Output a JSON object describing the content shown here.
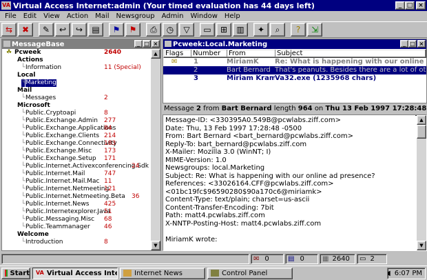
{
  "window": {
    "title": "Virtual Access Internet:admin (Your timed evaluation has 44 days left)",
    "app_icon": "VA"
  },
  "menu": [
    "File",
    "Edit",
    "View",
    "Action",
    "Mail",
    "Newsgroup",
    "Admin",
    "Window",
    "Help"
  ],
  "toolbar_icons": [
    "connect-icon",
    "stop-icon",
    "compose-icon",
    "reply-icon",
    "forward-icon",
    "address-book-icon",
    "flag-blue-icon",
    "flag-red-icon",
    "print-icon",
    "schedule-icon",
    "filter-icon",
    "tile-icon",
    "layout-four-icon",
    "layout-icon",
    "scripts-icon",
    "find-icon",
    "help-icon",
    "exit-icon"
  ],
  "message_base": {
    "title": "MessageBase",
    "rows": [
      {
        "label": "Pcweek",
        "count": "2640",
        "level": 0,
        "bold": true
      },
      {
        "label": "Actions",
        "count": "",
        "level": 1,
        "bold": true
      },
      {
        "label": "Information",
        "count": "11 (Special)",
        "level": 2,
        "bold": false
      },
      {
        "label": "Local",
        "count": "",
        "level": 1,
        "bold": true
      },
      {
        "label": "Marketing",
        "count": "",
        "level": 2,
        "bold": false,
        "selected": true
      },
      {
        "label": "Mail",
        "count": "",
        "level": 1,
        "bold": true
      },
      {
        "label": "Messages",
        "count": "2",
        "level": 2,
        "bold": false
      },
      {
        "label": "Microsoft",
        "count": "",
        "level": 1,
        "bold": true
      },
      {
        "label": "Public.Cryptoapi",
        "count": "8",
        "level": 2,
        "bold": false
      },
      {
        "label": "Public.Exchange.Admin",
        "count": "277",
        "level": 2,
        "bold": false
      },
      {
        "label": "Public.Exchange.Applications",
        "count": "84",
        "level": 2,
        "bold": false
      },
      {
        "label": "Public.Exchange.Clients",
        "count": "214",
        "level": 2,
        "bold": false
      },
      {
        "label": "Public.Exchange.Connectivity",
        "count": "183",
        "level": 2,
        "bold": false
      },
      {
        "label": "Public.Exchange.Misc",
        "count": "173",
        "level": 2,
        "bold": false
      },
      {
        "label": "Public.Exchange.Setup",
        "count": "171",
        "level": 2,
        "bold": false
      },
      {
        "label": "Public.Internet.Activexconferencing.Sdk",
        "count": "24",
        "level": 2,
        "bold": false
      },
      {
        "label": "Public.Internet.Mail",
        "count": "747",
        "level": 2,
        "bold": false
      },
      {
        "label": "Public.Internet.Mail.Mac",
        "count": "11",
        "level": 2,
        "bold": false
      },
      {
        "label": "Public.Internet.Netmeeting",
        "count": "121",
        "level": 2,
        "bold": false
      },
      {
        "label": "Public.Internet.Netmeeting.Beta",
        "count": "36",
        "level": 2,
        "bold": false
      },
      {
        "label": "Public.Internet.News",
        "count": "425",
        "level": 2,
        "bold": false
      },
      {
        "label": "Public.Internetexplorer.Java",
        "count": "51",
        "level": 2,
        "bold": false
      },
      {
        "label": "Public.Messaging.Misc",
        "count": "68",
        "level": 2,
        "bold": false
      },
      {
        "label": "Public.Teammanager",
        "count": "46",
        "level": 2,
        "bold": false
      },
      {
        "label": "Welcome",
        "count": "",
        "level": 1,
        "bold": true
      },
      {
        "label": "Introduction",
        "count": "8",
        "level": 2,
        "bold": false
      }
    ]
  },
  "message_list": {
    "title": "Pcweek:Local.Marketing",
    "columns": [
      "Flags",
      "Number",
      "From",
      "Subject"
    ],
    "rows": [
      {
        "flags": "open-mail-icon",
        "number": "1",
        "from": "MiriamK",
        "subject": "Re: What is happening with our online a"
      },
      {
        "flags": "",
        "number": "2",
        "from": "Bart Bernard",
        "subject": "That's peanuts. Besides there are a lot of ot"
      },
      {
        "flags": "",
        "number": "3",
        "from": "Miriam Kram",
        "subject": "Va32.exe (1235968 chars)"
      }
    ]
  },
  "message_header": {
    "message_label": "Message",
    "number": "2",
    "from_label": "from",
    "from": "Bart Bernard",
    "length_label": "length",
    "length": "964",
    "on_label": "on",
    "date": "Thu 13 Feb 1997 17:28:48 -"
  },
  "message_body": [
    "Message-ID: <330395A0.549B@pcwlabs.ziff.com>",
    "Date: Thu, 13 Feb 1997 17:28:48 -0500",
    "From: Bart Bernard <bart_bernard@pcwlabs.ziff.com>",
    "Reply-To: bart_bernard@pcwlabs.ziff.com",
    "X-Mailer: Mozilla 3.0 (WinNT; I)",
    "MIME-Version: 1.0",
    "Newsgroups: local.Marketing",
    "Subject: Re: What is happening with our online ad presence?",
    "References: <33026164.CFF@pcwlabs.ziff.com>",
    "<01bc19fc$96590280$90a170c6@miriamk>",
    "Content-Type: text/plain; charset=us-ascii",
    "Content-Transfer-Encoding: 7bit",
    "Path: matt4.pcwlabs.ziff.com",
    "X-NNTP-Posting-Host: matt4.pcwlabs.ziff.com",
    "",
    "MiriamK wrote:"
  ],
  "status": {
    "outbox": "0",
    "mail": "0",
    "news": "2640",
    "windows": "2"
  },
  "taskbar": {
    "start": "Start",
    "tasks": [
      "Virtual Access Intern...",
      "Internet News",
      "Control Panel"
    ],
    "time": "6:07 PM"
  }
}
